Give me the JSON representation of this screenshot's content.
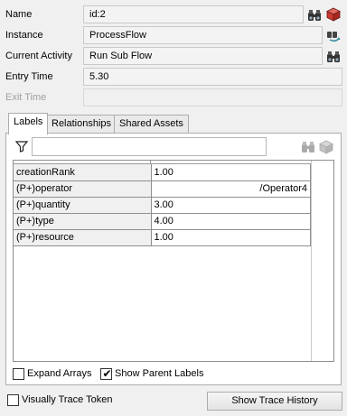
{
  "props": {
    "name_label": "Name",
    "name_value": "id:2",
    "instance_label": "Instance",
    "instance_value": "ProcessFlow",
    "activity_label": "Current Activity",
    "activity_value": "Run Sub Flow",
    "entry_label": "Entry Time",
    "entry_value": "5.30",
    "exit_label": "Exit Time",
    "exit_value": ""
  },
  "tabs": [
    {
      "label": "Labels",
      "active": true
    },
    {
      "label": "Relationships",
      "active": false
    },
    {
      "label": "Shared Assets",
      "active": false
    }
  ],
  "filter": {
    "value": ""
  },
  "labels_table": {
    "rows": [
      {
        "key": "creationRank",
        "value": "1.00"
      },
      {
        "key": "(P+)operator",
        "value": "/Operator4"
      },
      {
        "key": "(P+)quantity",
        "value": "3.00"
      },
      {
        "key": "(P+)type",
        "value": "4.00"
      },
      {
        "key": "(P+)resource",
        "value": "1.00"
      }
    ]
  },
  "options": {
    "expand_arrays_label": "Expand Arrays",
    "expand_arrays_checked": false,
    "show_parent_labels_label": "Show Parent Labels",
    "show_parent_labels_checked": true,
    "visually_trace_label": "Visually Trace Token",
    "visually_trace_checked": false
  },
  "buttons": {
    "show_trace_history": "Show Trace History"
  },
  "icons": {
    "find": "binoculars-icon",
    "cube": "cube-icon",
    "sampler": "sampler-icon",
    "filter": "filter-icon"
  },
  "colors": {
    "cube_red": "#cc3a2f",
    "panel_bg": "#f0f0f0"
  }
}
